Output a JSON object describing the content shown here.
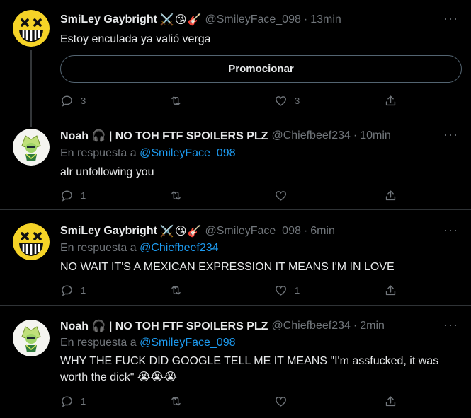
{
  "tweets": [
    {
      "name": "SmiLey Gaybright",
      "name_emojis": [
        "⚔️",
        "😘",
        "🎸"
      ],
      "handle": "@SmileyFace_098",
      "sep": "·",
      "time": "13min",
      "reply_prefix": "",
      "reply_to": "",
      "text": "Estoy enculada ya valió verga",
      "promote_label": "Promocionar",
      "reply_count": "3",
      "retweet_count": "",
      "like_count": "3",
      "avatar": "smiley-avatar"
    },
    {
      "name": "Noah 🎧 | NO TOH FTF SPOILERS PLZ",
      "name_emojis": [],
      "handle": "@Chiefbeef234",
      "sep": "·",
      "time": "10min",
      "reply_prefix": "En respuesta a",
      "reply_to": "@SmileyFace_098",
      "text": "alr unfollowing you",
      "reply_count": "1",
      "retweet_count": "",
      "like_count": "",
      "avatar": "peridot-avatar"
    },
    {
      "name": "SmiLey Gaybright",
      "name_emojis": [
        "⚔️",
        "😘",
        "🎸"
      ],
      "handle": "@SmileyFace_098",
      "sep": "·",
      "time": "6min",
      "reply_prefix": "En respuesta a",
      "reply_to": "@Chiefbeef234",
      "text": "NO WAIT IT'S A MEXICAN EXPRESSION IT MEANS I'M IN LOVE",
      "reply_count": "1",
      "retweet_count": "",
      "like_count": "1",
      "avatar": "smiley-avatar"
    },
    {
      "name": "Noah 🎧 | NO TOH FTF SPOILERS PLZ",
      "name_emojis": [],
      "handle": "@Chiefbeef234",
      "sep": "·",
      "time": "2min",
      "reply_prefix": "En respuesta a",
      "reply_to": "@SmileyFace_098",
      "text": "WHY THE FUCK DID GOOGLE TELL ME IT MEANS \"I'm assfucked, it was worth the dick\" 😭😭😭",
      "reply_count": "1",
      "retweet_count": "",
      "like_count": "",
      "avatar": "peridot-avatar"
    }
  ],
  "more_icon": "more-horizontal-icon",
  "icons": [
    "reply-icon",
    "retweet-icon",
    "like-icon",
    "share-icon"
  ],
  "colors": {
    "background": "#000000",
    "text": "#e7e9ea",
    "muted": "#71767b",
    "accent": "#1d9bf0"
  }
}
